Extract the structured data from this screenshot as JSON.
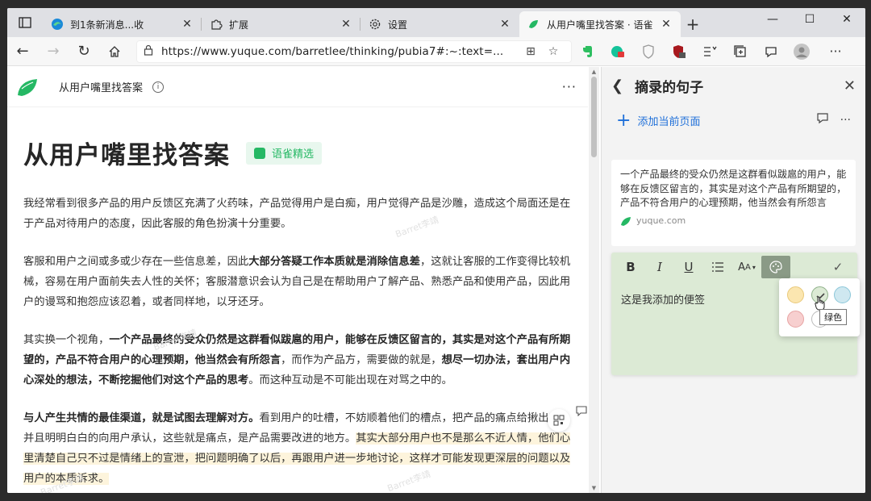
{
  "tabs": [
    {
      "title": "到1条新消息...收",
      "favicon": "edge-icon"
    },
    {
      "title": "扩展",
      "favicon": "puzzle-icon"
    },
    {
      "title": "设置",
      "favicon": "gear-icon"
    },
    {
      "title": "从用户嘴里找答案 · 语雀",
      "favicon": "yuque-icon",
      "active": true
    }
  ],
  "toolbar": {
    "url": "https://www.yuque.com/barretlee/thinking/pubia7#:~:text=..."
  },
  "doc": {
    "header_title": "从用户嘴里找答案",
    "title": "从用户嘴里找答案",
    "badge": "语雀精选",
    "p1": "我经常看到很多产品的用户反馈区充满了火药味，产品觉得用户是白痴，用户觉得产品是沙雕，造成这个局面还是在于产品对待用户的态度，因此客服的角色扮演十分重要。",
    "p2_a": "客服和用户之间或多或少存在一些信息差，因此",
    "p2_b": "大部分答疑工作本质就是消除信息差",
    "p2_c": "，这就让客服的工作变得比较机械，容易在用户面前失去人性的关怀；客服潜意识会认为自己是在帮助用户了解产品、熟悉产品和使用产品，因此用户的谩骂和抱怨应该忍着，或者同样地，以牙还牙。",
    "p3_a": "其实换一个视角，",
    "p3_b": "一个产品最终的受众仍然是这群看似跋扈的用户，能够在反馈区留言的，其实是对这个产品有所期望的，产品不符合用户的心理预期，他当然会有所怨言",
    "p3_c": "，而作为产品方，需要做的就是，",
    "p3_d": "想尽一切办法，套出用户内心深处的想法，不断挖掘他们对这个产品的思考",
    "p3_e": "。而这种互动是不可能出现在对骂之中的。",
    "p4_a": "与人产生共情的最佳渠道，就是试图去理解对方。",
    "p4_b": "看到用户的吐槽，不妨顺着他们的槽点，把产品的痛点给揪出来，并且明明白白的向用户承认，这些就是痛点，是产品需要改进的地方。",
    "p4_c": "其实大部分用户也不是那么不近人情，他们心里清楚自己只不过是情绪上的宣泄，把问题明确了以后，再跟用户进一步地讨论，这样才可能发现更深层的问题以及用户的本质诉求。",
    "watermark": "Barret李靖"
  },
  "panel": {
    "title": "摘录的句子",
    "add_label": "添加当前页面",
    "quote": "一个产品最终的受众仍然是这群看似跋扈的用户，能够在反馈区留言的，其实是对这个产品有所期望的，产品不符合用户的心理预期，他当然会有所怨言",
    "quote_source": "yuque.com",
    "note_text": "这是我添加的便签",
    "tooltip": "绿色",
    "colors": [
      "#fbe6b0",
      "#dcead5",
      "#cfe8f0",
      "#f7cfcf",
      "#ffffff"
    ]
  }
}
